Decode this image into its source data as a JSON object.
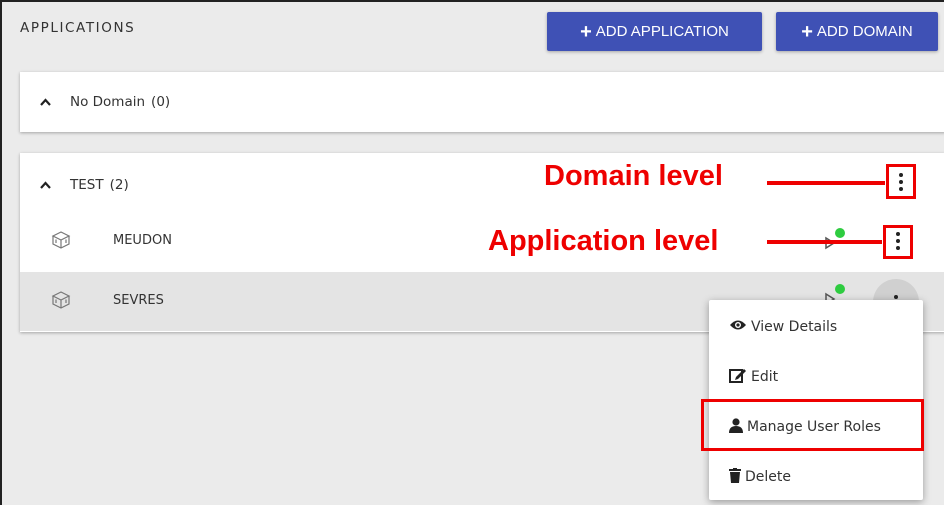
{
  "header": {
    "title": "APPLICATIONS",
    "add_application_label": "ADD APPLICATION",
    "add_domain_label": "ADD DOMAIN",
    "button_color": "#3f51b5"
  },
  "domains": [
    {
      "name": "No Domain",
      "count": "(0)",
      "expanded": true,
      "applications": []
    },
    {
      "name": "TEST",
      "count": "(2)",
      "expanded": true,
      "applications": [
        {
          "name": "MEUDON",
          "icon": "cube-icon",
          "status_color": "#2ecc40"
        },
        {
          "name": "SEVRES",
          "icon": "cube-icon",
          "status_color": "#2ecc40",
          "selected": true
        }
      ]
    }
  ],
  "annotations": {
    "domain_level": "Domain level",
    "application_level": "Application level",
    "color": "#e00000"
  },
  "context_menu": {
    "items": [
      {
        "label": "View Details",
        "icon": "eye-icon"
      },
      {
        "label": "Edit",
        "icon": "edit-icon"
      },
      {
        "label": "Manage User Roles",
        "icon": "user-icon",
        "highlighted": true
      },
      {
        "label": "Delete",
        "icon": "trash-icon"
      }
    ]
  }
}
